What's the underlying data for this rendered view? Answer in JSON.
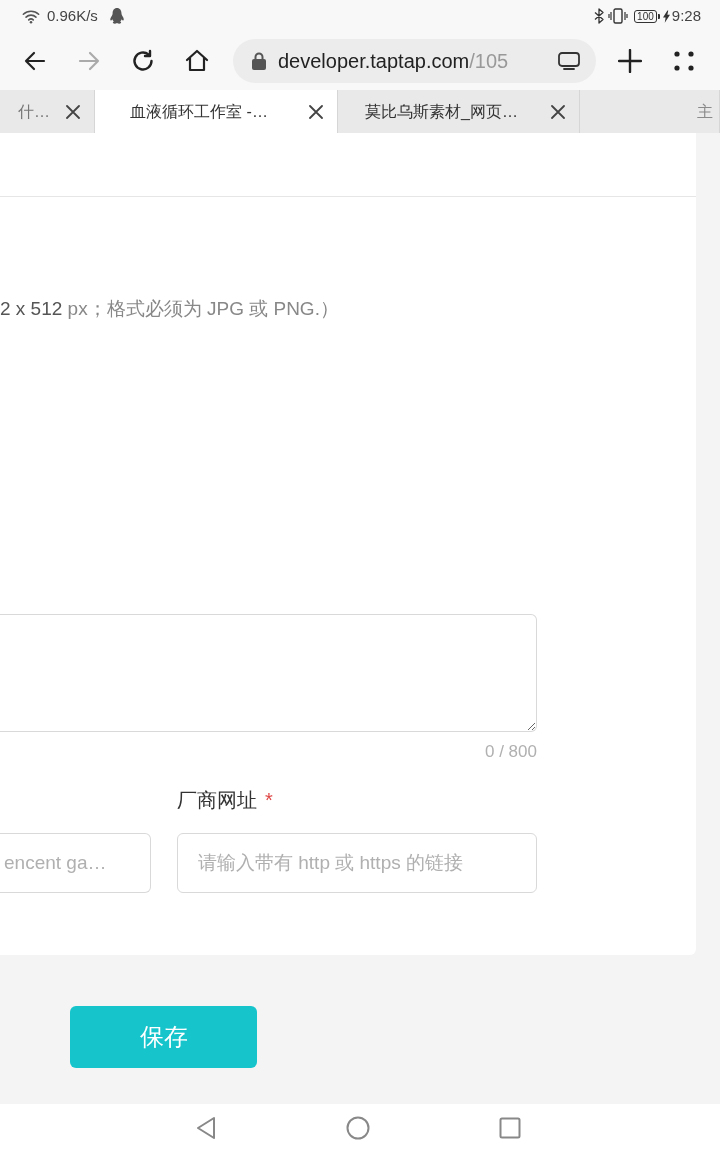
{
  "status_bar": {
    "speed": "0.96K/s",
    "battery": "100",
    "time": "9:28"
  },
  "toolbar": {
    "buttons": [
      {
        "kind": "back",
        "disabled": false
      },
      {
        "kind": "forward",
        "disabled": true
      },
      {
        "kind": "reload",
        "disabled": false
      },
      {
        "kind": "home",
        "disabled": false
      }
    ],
    "address": {
      "host": "developer.taptap.com",
      "path": "/105"
    }
  },
  "tabs": [
    {
      "label": "什…",
      "selected": false,
      "closable": true
    },
    {
      "label": "血液循环工作室 -…",
      "selected": true,
      "closable": true
    },
    {
      "label": "莫比乌斯素材_网页…",
      "selected": false,
      "closable": true
    },
    {
      "label": "主",
      "selected": false,
      "closable": false
    }
  ],
  "form": {
    "hint": "**2 x 512** px；格式必须为 JPG 或 PNG.）",
    "description": {
      "counter": "0 / 800"
    },
    "fields": [
      {
        "placeholder": "encent ga…"
      },
      {
        "label": "厂商网址",
        "required_mark": "*",
        "placeholder": "请输入带有 http 或 https 的链接"
      }
    ]
  },
  "save_button": "保存"
}
